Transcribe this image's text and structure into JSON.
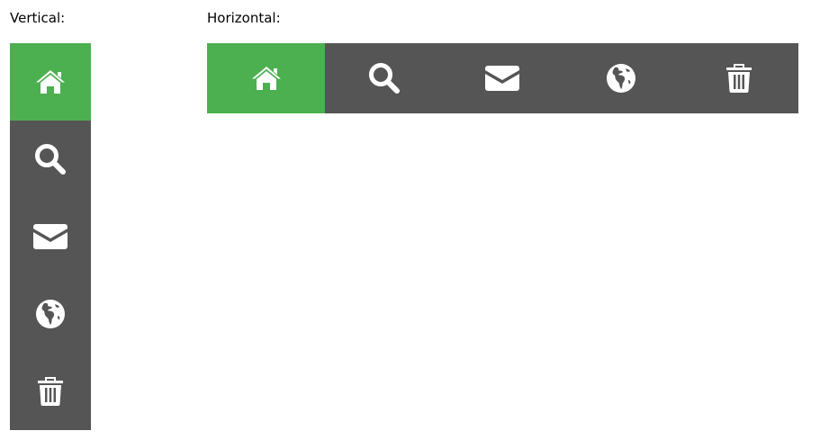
{
  "labels": {
    "vertical": "Vertical:",
    "horizontal": "Horizontal:"
  },
  "colors": {
    "bar_background": "#555555",
    "active_background": "#4CAF50",
    "icon_color": "#ffffff"
  },
  "nav_items": [
    {
      "icon": "home-icon",
      "active": true
    },
    {
      "icon": "search-icon",
      "active": false
    },
    {
      "icon": "envelope-icon",
      "active": false
    },
    {
      "icon": "globe-icon",
      "active": false
    },
    {
      "icon": "trash-icon",
      "active": false
    }
  ]
}
